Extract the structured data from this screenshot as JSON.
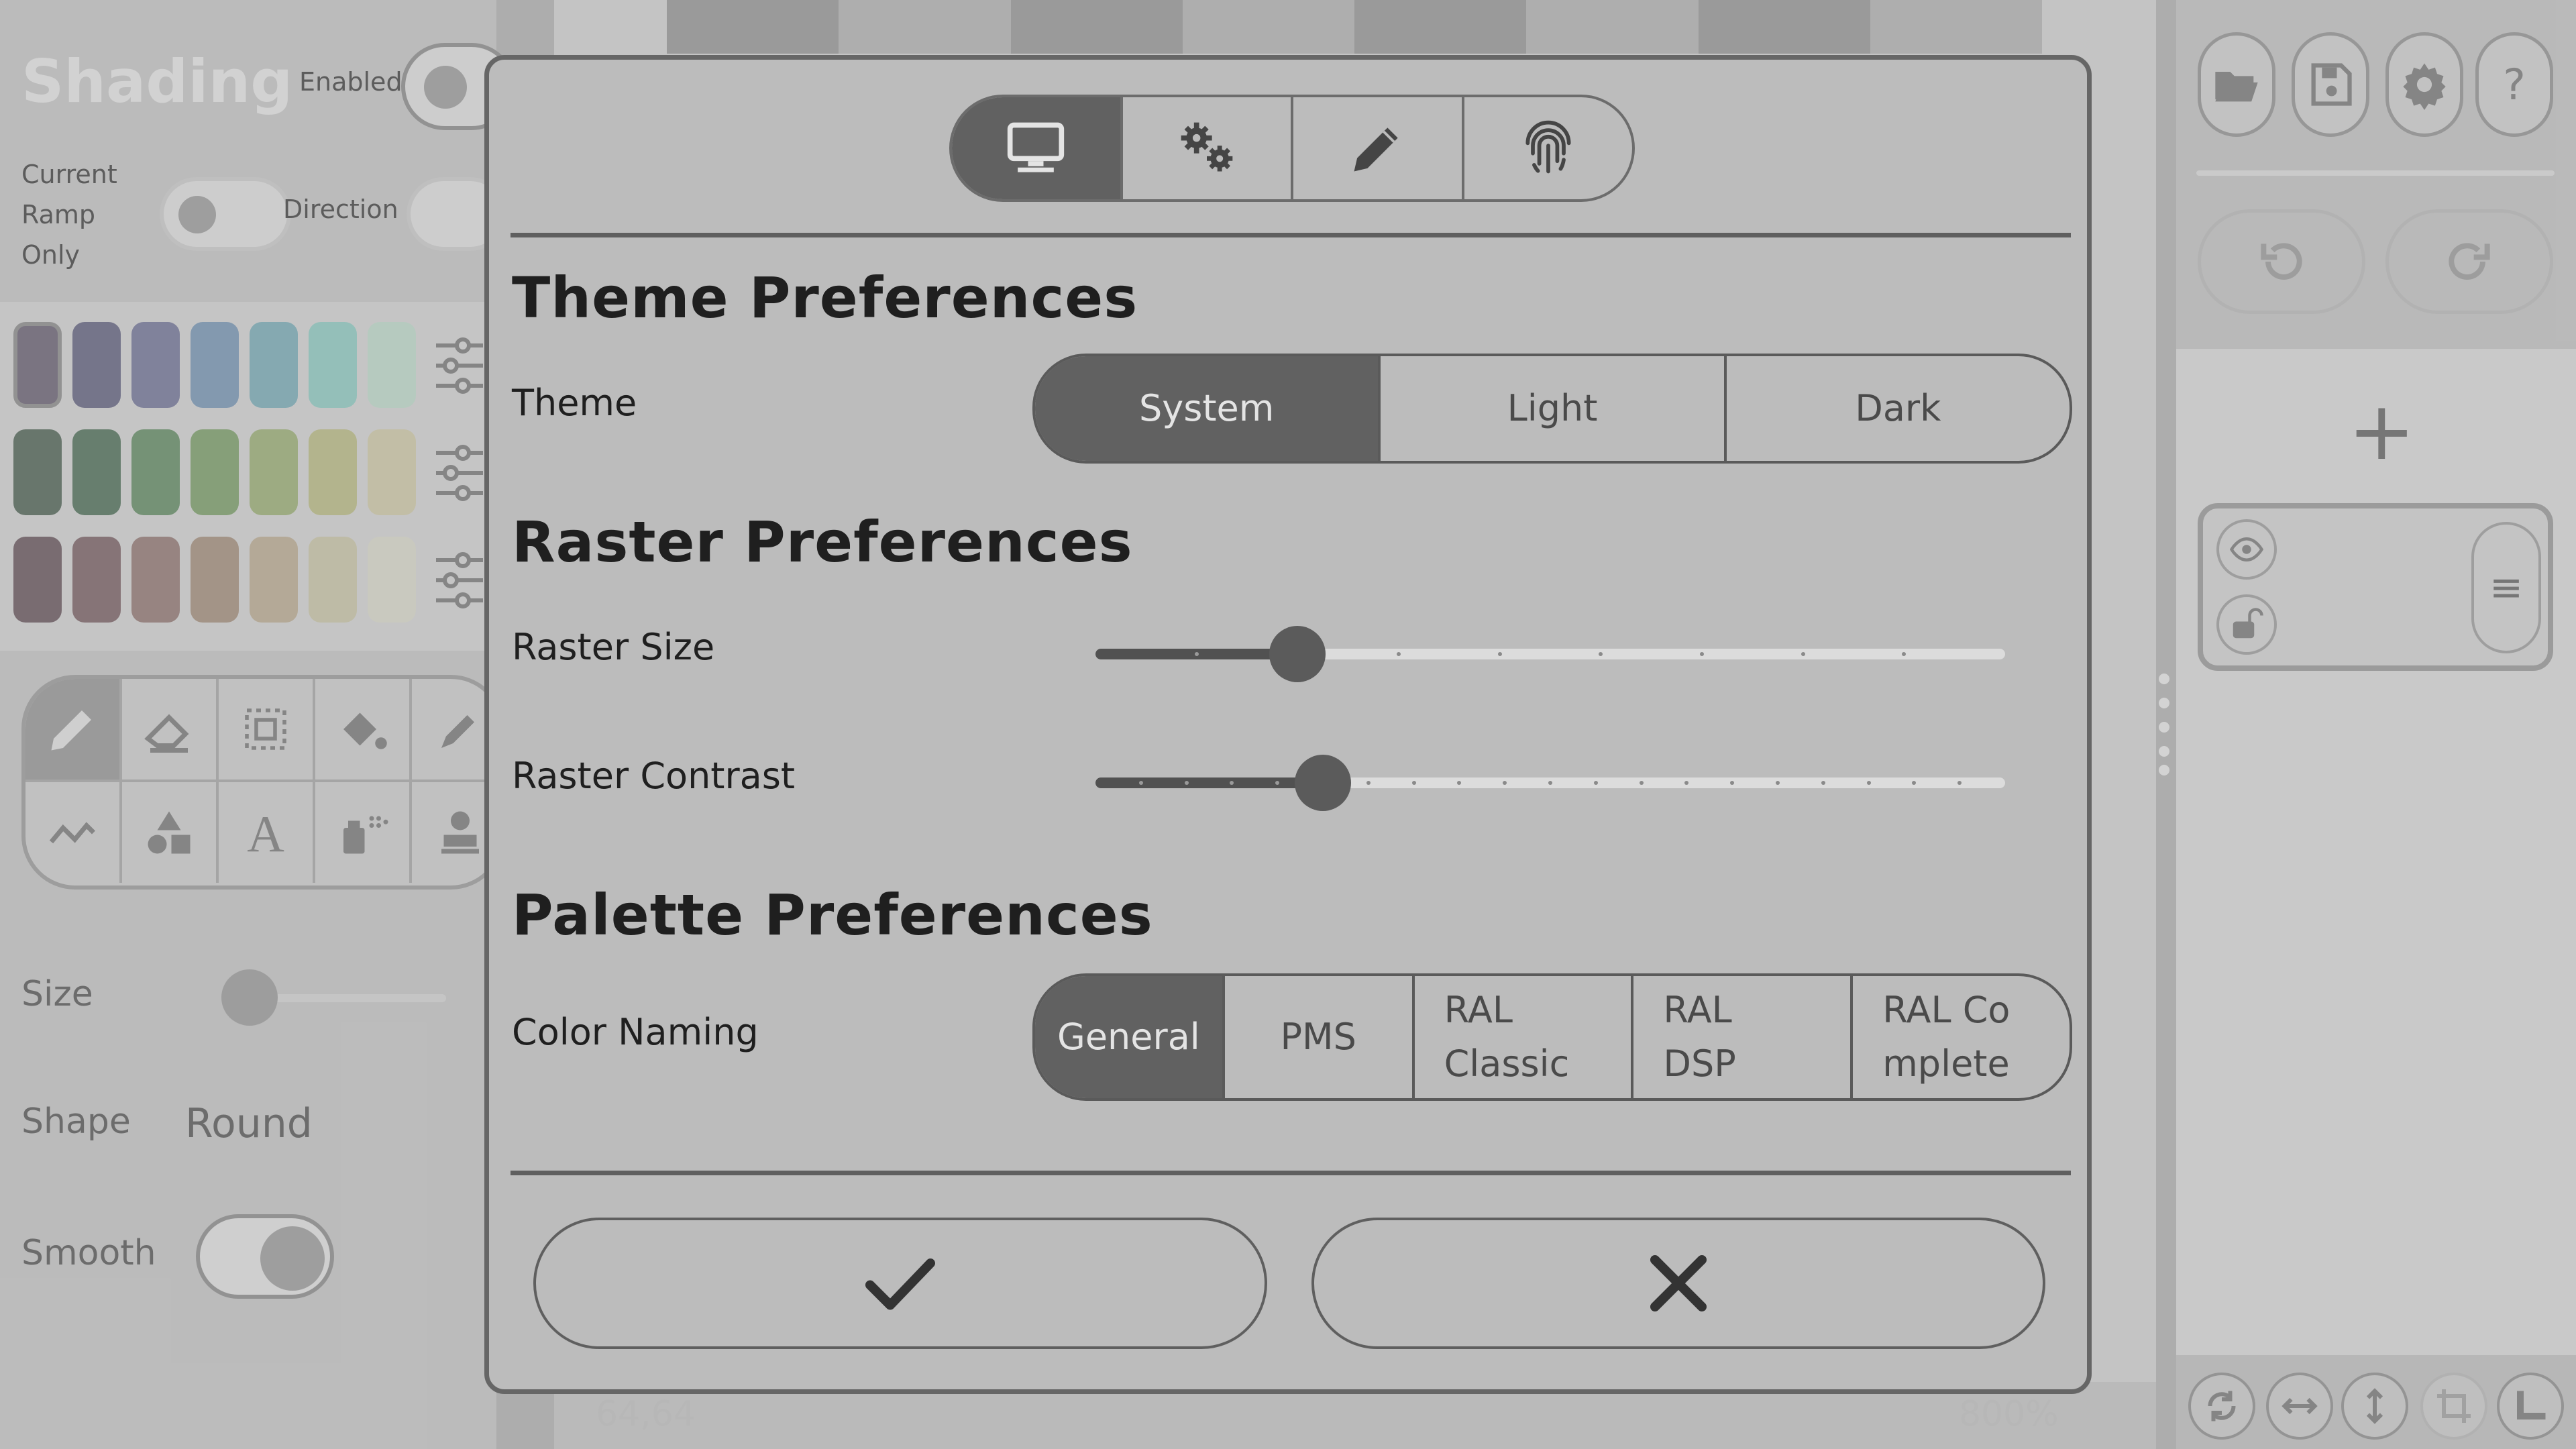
{
  "app": {
    "left_panel": {
      "title": "Shading",
      "enabled_label": "Enabled",
      "current_ramp_only_label": "Current\nRamp\nOnly",
      "direction_label": "Direction",
      "size_label": "Size",
      "shape_label": "Shape",
      "shape_value": "Round",
      "smooth_label": "Smooth",
      "palette_rows": [
        [
          "#7c7484",
          "#757590",
          "#8386a6",
          "#87a3bf",
          "#8ab8c2",
          "#9dd4cc",
          "#c8e2d4"
        ],
        [
          "#65766a",
          "#63806c",
          "#759a76",
          "#8bab7a",
          "#a8ba86",
          "#c4c694",
          "#d8d2b4"
        ],
        [
          "#7a6a70",
          "#8b7478",
          "#a08884",
          "#b09d8c",
          "#c6b8a0",
          "#d3cfb4",
          "#e0e0d4"
        ]
      ]
    },
    "status_bar": {
      "coordinates": "64,64",
      "zoom": "800%"
    }
  },
  "dialog": {
    "tabs": [
      {
        "icon": "monitor-icon",
        "active": true
      },
      {
        "icon": "gears-icon",
        "active": false
      },
      {
        "icon": "pencil-icon",
        "active": false
      },
      {
        "icon": "fingerprint-icon",
        "active": false
      }
    ],
    "theme": {
      "section_title": "Theme Preferences",
      "label": "Theme",
      "options": [
        "System",
        "Light",
        "Dark"
      ],
      "selected": "System"
    },
    "raster": {
      "section_title": "Raster Preferences",
      "size_label": "Raster Size",
      "size_level": 2,
      "size_steps": 9,
      "contrast_label": "Raster Contrast",
      "contrast_level": 5,
      "contrast_steps": 20
    },
    "palette": {
      "section_title": "Palette Preferences",
      "label": "Color Naming",
      "options": [
        "General",
        "PMS",
        "RAL\nClassic",
        "RAL\nDSP",
        "RAL Co\nmplete"
      ],
      "selected": "General"
    },
    "confirm_icon": "check-icon",
    "cancel_icon": "close-icon"
  }
}
